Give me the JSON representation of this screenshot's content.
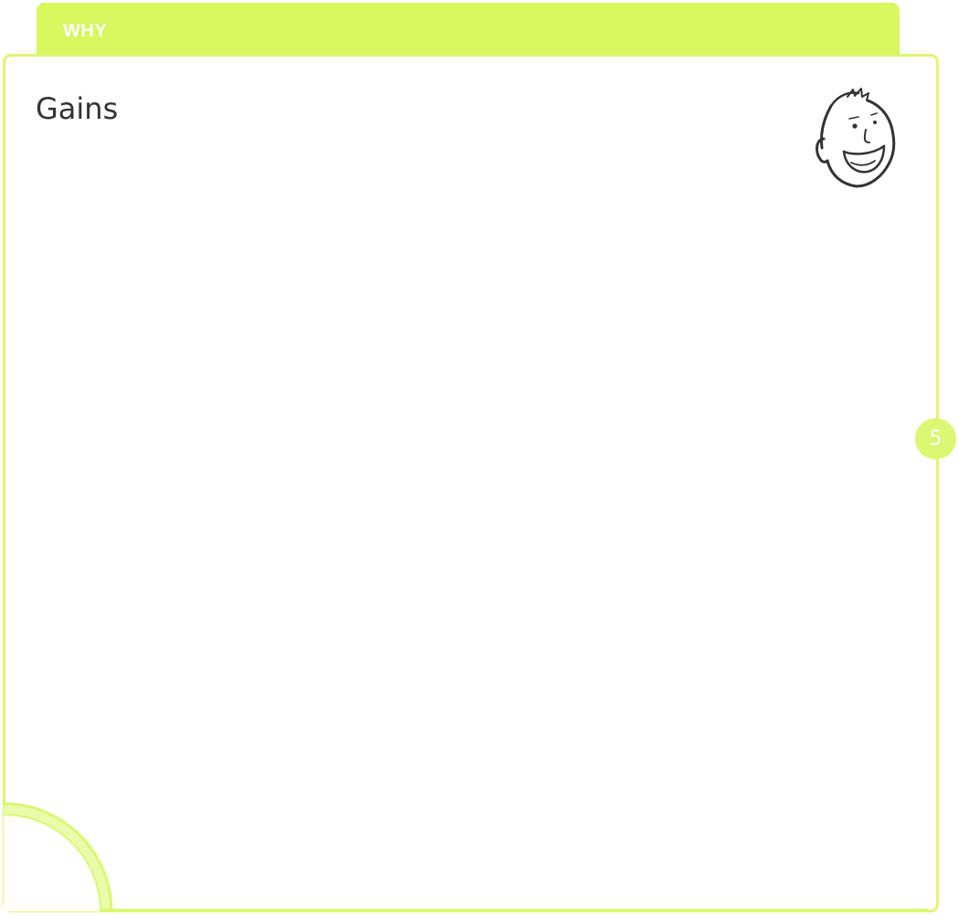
{
  "header": {
    "tab_label": "WHY"
  },
  "card": {
    "title": "Gains"
  },
  "page_badge": {
    "number": "5"
  },
  "icons": {
    "customer_face": "smiling-face-sketch-icon"
  },
  "colors": {
    "accent": "#d9f75f",
    "border": "#dcf772",
    "corner_light": "#eafbaa",
    "title_text": "#333333",
    "label_text": "#ffffff"
  }
}
